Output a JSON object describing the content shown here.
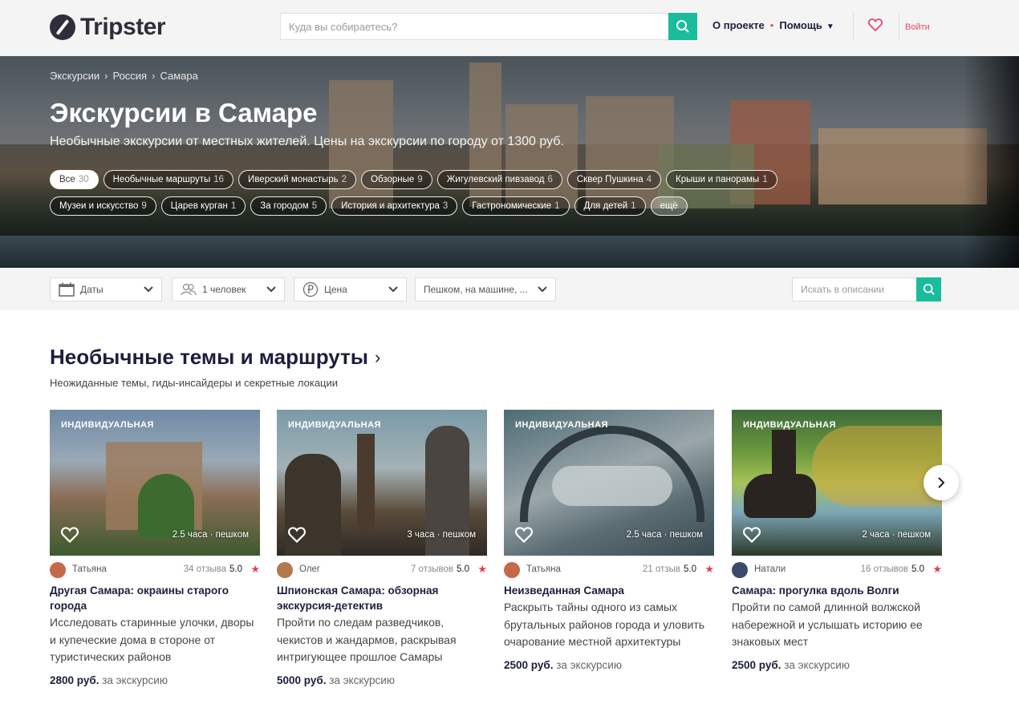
{
  "header": {
    "logo_text": "Tripster",
    "search_placeholder": "Куда вы собираетесь?",
    "nav_about": "О проекте",
    "nav_dot": "•",
    "nav_help": "Помощь",
    "nav_help_caret": "▼",
    "login": "Войти",
    "accent": "#1abc9c",
    "brand_red": "#e8496b"
  },
  "hero": {
    "breadcrumbs": [
      "Экскурсии",
      "Россия",
      "Самара"
    ],
    "breadcrumb_sep": "›",
    "title": "Экскурсии в Самаре",
    "subtitle": "Необычные экскурсии от местных жителей. Цены на экскурсии по городу от 1300 руб.",
    "chips_row1": [
      {
        "label": "Все",
        "count": "30"
      },
      {
        "label": "Необычные маршруты",
        "count": "16"
      },
      {
        "label": "Иверский монастырь",
        "count": "2"
      },
      {
        "label": "Обзорные",
        "count": "9"
      },
      {
        "label": "Жигулевский пивзавод",
        "count": "6"
      },
      {
        "label": "Сквер Пушкина",
        "count": "4"
      },
      {
        "label": "Крыши и панорамы",
        "count": "1"
      }
    ],
    "chips_row2": [
      {
        "label": "Музеи и искусство",
        "count": "9"
      },
      {
        "label": "Царев курган",
        "count": "1"
      },
      {
        "label": "За городом",
        "count": "5"
      },
      {
        "label": "История и архитектура",
        "count": "3"
      },
      {
        "label": "Гастрономические",
        "count": "1"
      },
      {
        "label": "Для детей",
        "count": "1"
      }
    ],
    "more": "ещё"
  },
  "filters": {
    "dates": "Даты",
    "people": "1 человек",
    "price": "Цена",
    "transport": "Пешком, на машине, ...",
    "search_placeholder": "Искать в описании"
  },
  "section": {
    "title": "Необычные темы и маршруты",
    "arrow": "›",
    "subtitle": "Неожиданные темы, гиды-инсайдеры и секретные локации"
  },
  "cards": [
    {
      "badge": "индивидуальная",
      "duration": "2.5 часа · пешком",
      "guide": "Татьяна",
      "reviews": "34 отзыва",
      "rating": "5.0",
      "title": "Другая Самара: окраины старого города",
      "desc": "Исследовать старинные улочки, дворы и купеческие дома в стороне от туристических районов",
      "price": "2800 руб.",
      "price_suffix": "за экскурсию",
      "photo_colors": [
        "#6f8aa6",
        "#8a6e55",
        "#3d5a2f"
      ],
      "avatar_color": "#c46a4a"
    },
    {
      "badge": "индивидуальная",
      "duration": "3 часа · пешком",
      "guide": "Олег",
      "reviews": "7 отзывов",
      "rating": "5.0",
      "title": "Шпионская Самара: обзорная экскурсия-детектив",
      "desc": "Пройти по следам разведчиков, чекистов и жандармов, раскрывая интригующее прошлое Самары",
      "price": "5000 руб.",
      "price_suffix": "за экскурсию",
      "photo_colors": [
        "#7b9aa8",
        "#5a4b3a",
        "#2e2a26"
      ],
      "avatar_color": "#b07a4c"
    },
    {
      "badge": "индивидуальная",
      "duration": "2.5 часа · пешком",
      "guide": "Татьяна",
      "reviews": "21 отзыв",
      "rating": "5.0",
      "title": "Неизведанная Самара",
      "desc": "Раскрыть тайны одного из самых брутальных районов города и уловить очарование местной архитектуры",
      "price": "2500 руб.",
      "price_suffix": "за экскурсию",
      "photo_colors": [
        "#4e6b75",
        "#9aa6aa",
        "#3a4a52"
      ],
      "avatar_color": "#c46a4a"
    },
    {
      "badge": "индивидуальная",
      "duration": "2 часа · пешком",
      "guide": "Натали",
      "reviews": "16 отзывов",
      "rating": "5.0",
      "title": "Самара: прогулка вдоль Волги",
      "desc": "Пройти по самой длинной волжской набережной и услышать историю ее знаковых мест",
      "price": "2500 руб.",
      "price_suffix": "за экскурсию",
      "photo_colors": [
        "#3d6b3a",
        "#8fb04a",
        "#2c3a2a"
      ],
      "avatar_color": "#3a4a6a"
    }
  ]
}
